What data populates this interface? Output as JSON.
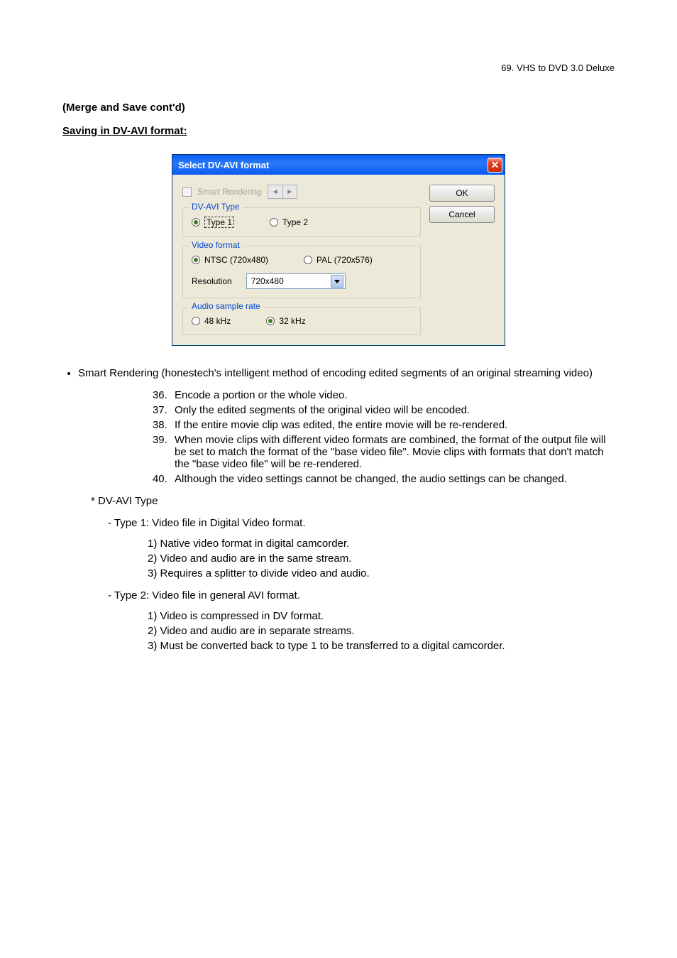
{
  "header": {
    "page_label": "69.   VHS to DVD 3.0 Deluxe"
  },
  "titles": {
    "section": "(Merge and Save cont'd)",
    "subsection": "Saving in DV-AVI format:"
  },
  "dialog": {
    "title": "Select DV-AVI format",
    "smart_rendering_label": "Smart Rendering",
    "ok_label": "OK",
    "cancel_label": "Cancel",
    "groups": {
      "dvavi": {
        "legend": "DV-AVI Type",
        "type1": "Type 1",
        "type2": "Type 2"
      },
      "video": {
        "legend": "Video format",
        "ntsc": "NTSC (720x480)",
        "pal": "PAL (720x576)",
        "resolution_label": "Resolution",
        "resolution_value": "720x480"
      },
      "audio": {
        "legend": "Audio sample rate",
        "khz48": "48 kHz",
        "khz32": "32 kHz"
      }
    }
  },
  "bullets": {
    "smart_rendering": "Smart Rendering (honestech's intelligent method of encoding edited segments of an original streaming video)"
  },
  "numbered": {
    "n36": "Encode a portion or the whole video.",
    "n37": "Only the edited segments of the original video will be encoded.",
    "n38": "If the entire movie clip was edited, the entire movie will be re-rendered.",
    "n39": "When movie clips with different video formats are combined, the format of the output file will be set to match the format of the \"base video file\". Movie clips with formats that don't match the \"base video file\" will be re-rendered.",
    "n40": "Although the video settings cannot be changed, the audio settings can be changed."
  },
  "dvavi_section": {
    "header": "*   DV-AVI Type",
    "type1_header": "- Type 1: Video file in Digital Video format.",
    "type1": {
      "l1": "1) Native video format in digital camcorder.",
      "l2": "2) Video and audio are in the same stream.",
      "l3": "3) Requires a splitter to divide video and audio."
    },
    "type2_header": "- Type 2: Video file in general AVI format.",
    "type2": {
      "l1": "1) Video is compressed in DV format.",
      "l2": "2) Video and audio are in separate streams.",
      "l3": "3) Must be converted back to type 1 to be transferred to a digital camcorder."
    }
  }
}
